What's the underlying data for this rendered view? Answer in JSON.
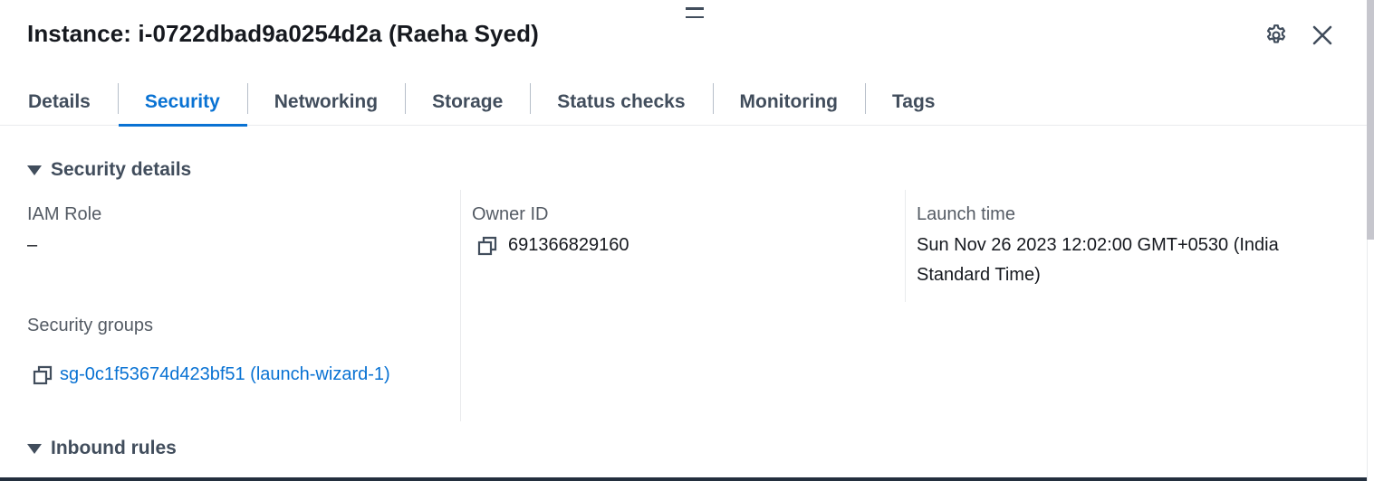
{
  "panel": {
    "title": "Instance: i-0722dbad9a0254d2a (Raeha Syed)"
  },
  "icons": {
    "drag": "drag-handle-icon",
    "settings": "gear-icon",
    "close": "close-icon",
    "copy": "copy-icon",
    "caret": "caret-down-icon"
  },
  "tabs": [
    {
      "label": "Details"
    },
    {
      "label": "Security"
    },
    {
      "label": "Networking"
    },
    {
      "label": "Storage"
    },
    {
      "label": "Status checks"
    },
    {
      "label": "Monitoring"
    },
    {
      "label": "Tags"
    }
  ],
  "active_tab": "Security",
  "security_details": {
    "heading": "Security details",
    "iam_role": {
      "label": "IAM Role",
      "value": "–"
    },
    "owner_id": {
      "label": "Owner ID",
      "value": "691366829160"
    },
    "launch_time": {
      "label": "Launch time",
      "value": "Sun Nov 26 2023 12:02:00 GMT+0530 (India Standard Time)"
    },
    "security_groups": {
      "label": "Security groups",
      "value": "sg-0c1f53674d423bf51 (launch-wizard-1)"
    }
  },
  "inbound_rules": {
    "heading": "Inbound rules"
  },
  "colors": {
    "accent": "#0972d3",
    "text": "#16191f",
    "muted": "#414d5c",
    "label": "#545b64",
    "divider": "#e9ebed"
  }
}
